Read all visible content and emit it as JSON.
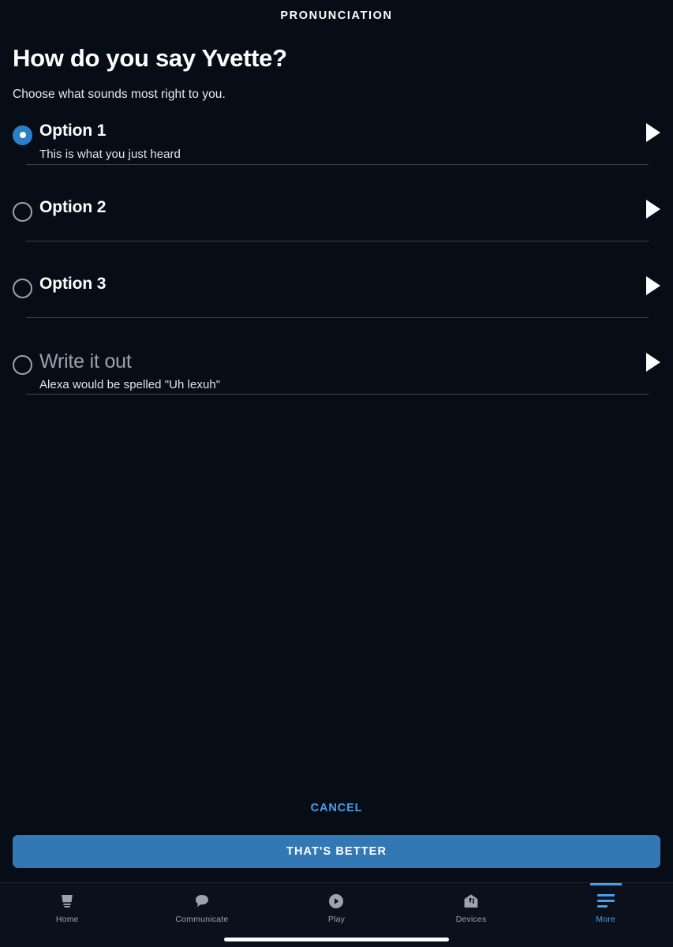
{
  "header": {
    "title": "PRONUNCIATION"
  },
  "main": {
    "page_title": "How do you say Yvette?",
    "subtitle": "Choose what sounds most right to you.",
    "options": [
      {
        "label": "Option 1",
        "description": "This is what you just heard",
        "selected": true,
        "muted": false,
        "play_icon": "play-triangle-icon"
      },
      {
        "label": "Option 2",
        "description": "",
        "selected": false,
        "muted": false,
        "play_icon": "play-triangle-icon"
      },
      {
        "label": "Option 3",
        "description": "",
        "selected": false,
        "muted": false,
        "play_icon": "play-triangle-icon"
      },
      {
        "label": "Write it out",
        "description": "Alexa would be spelled \"Uh lexuh\"",
        "selected": false,
        "muted": true,
        "play_icon": "play-triangle-icon"
      }
    ]
  },
  "footer": {
    "cancel_label": "CANCEL",
    "confirm_label": "THAT'S BETTER"
  },
  "tabbar": {
    "items": [
      {
        "label": "Home",
        "icon": "echo-device-icon",
        "active": false
      },
      {
        "label": "Communicate",
        "icon": "speech-bubble-icon",
        "active": false
      },
      {
        "label": "Play",
        "icon": "play-circle-icon",
        "active": false
      },
      {
        "label": "Devices",
        "icon": "house-bulb-icon",
        "active": false
      },
      {
        "label": "More",
        "icon": "hamburger-lines-icon",
        "active": true
      }
    ]
  },
  "colors": {
    "background": "#070d17",
    "accent_blue": "#2d7fc4",
    "button_blue": "#3278b4",
    "link_blue": "#4a9eeb",
    "muted_text": "#9aa3ae",
    "divider": "#3a4450"
  }
}
